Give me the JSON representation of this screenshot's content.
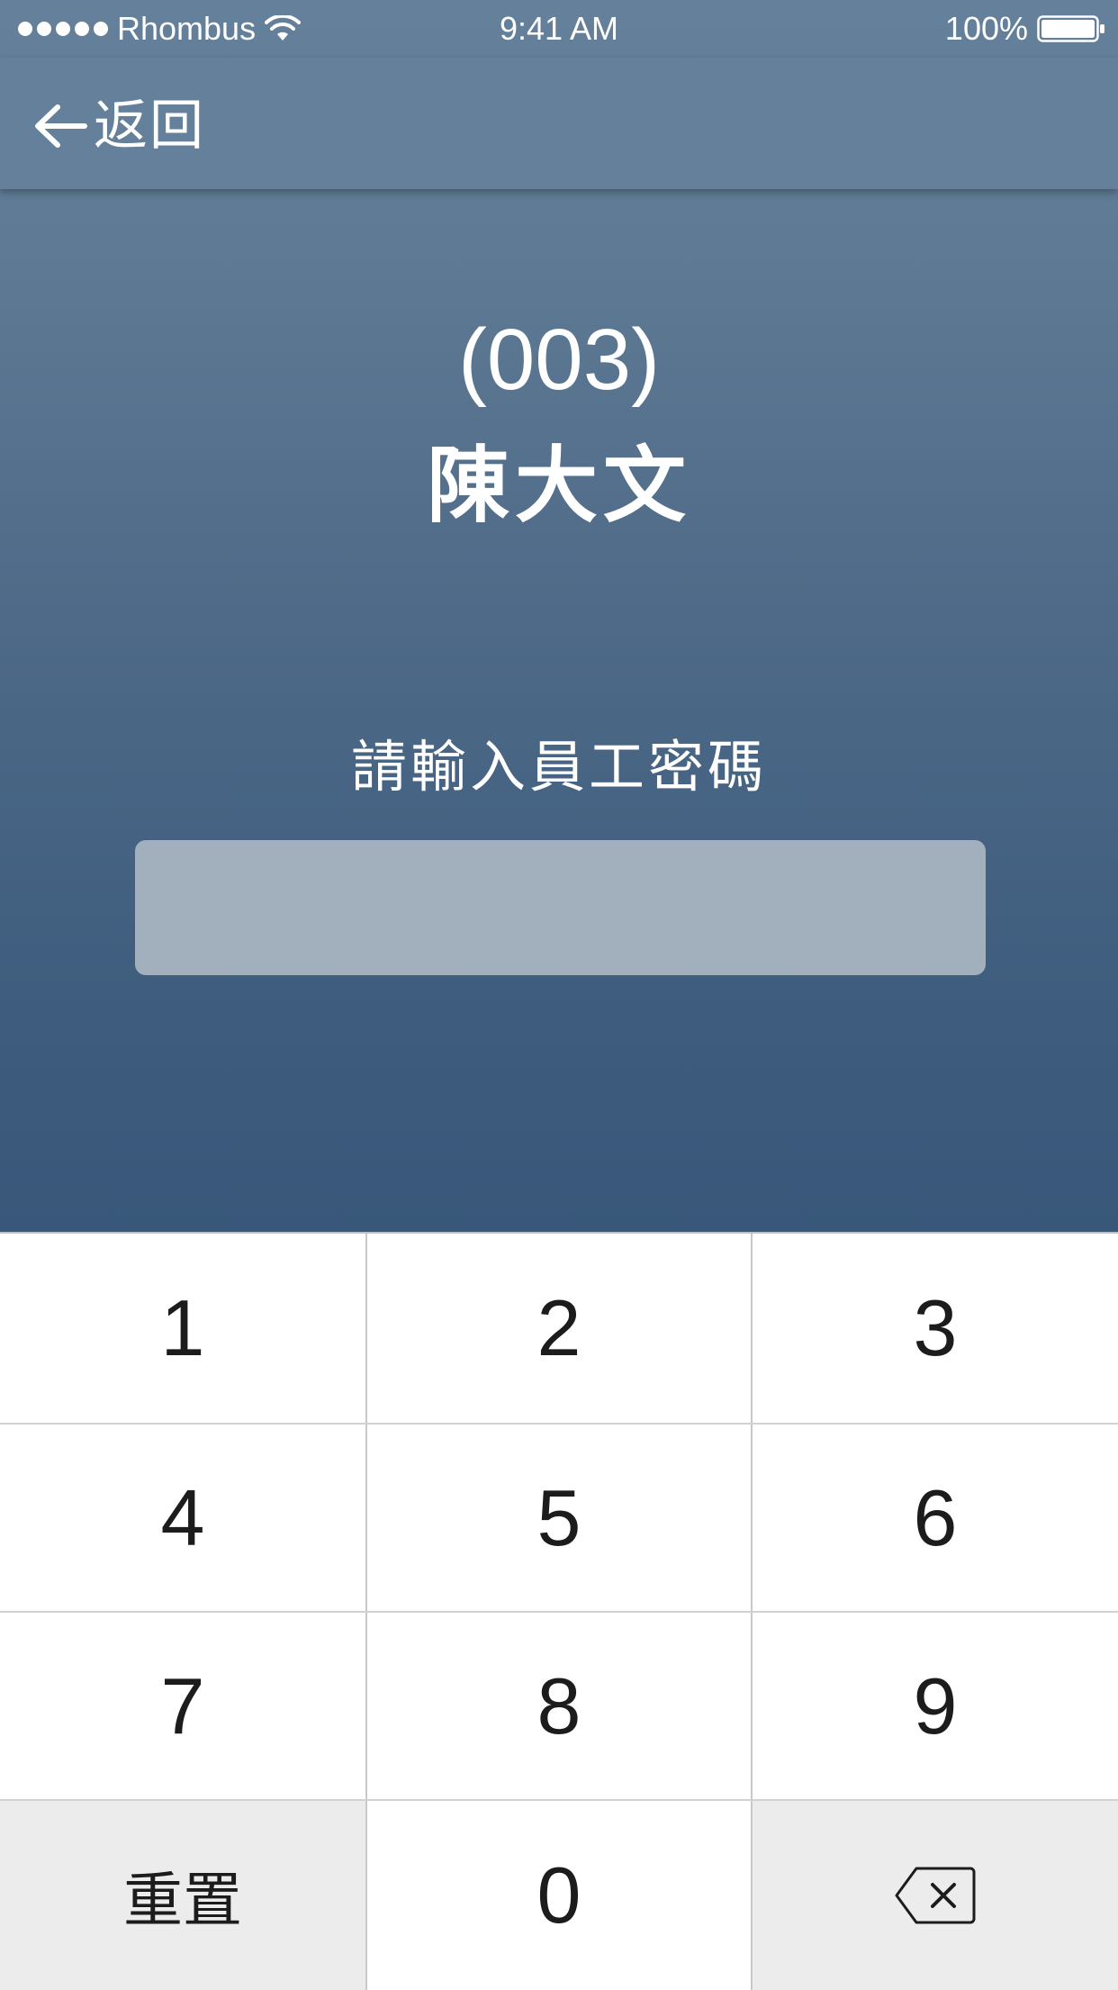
{
  "status_bar": {
    "carrier": "Rhombus",
    "time": "9:41 AM",
    "battery": "100%",
    "signal_icon": "signal-dots-icon",
    "wifi_icon": "wifi-icon",
    "battery_icon": "battery-icon"
  },
  "nav": {
    "back_label": "返回",
    "back_icon": "arrow-left-icon"
  },
  "employee": {
    "code": "(003)",
    "name": "陳大文"
  },
  "password": {
    "prompt": "請輸入員工密碼",
    "value": "",
    "placeholder": ""
  },
  "keypad": {
    "keys": [
      "1",
      "2",
      "3",
      "4",
      "5",
      "6",
      "7",
      "8",
      "9"
    ],
    "zero": "0",
    "reset_label": "重置",
    "backspace_icon": "backspace-icon"
  },
  "colors": {
    "header_top": "#65809a",
    "header_bottom": "#38577a",
    "input_fill": "#a2b0be",
    "special_key": "#ececec"
  }
}
